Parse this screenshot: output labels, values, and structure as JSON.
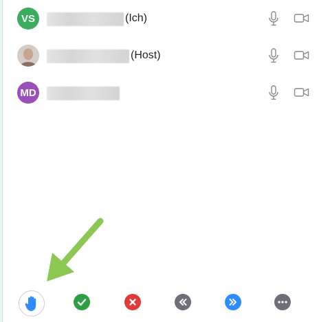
{
  "participants": [
    {
      "initials": "VS",
      "role": "(Ich)",
      "avatar_color": "#3aac5d"
    },
    {
      "initials": "",
      "role": "(Host)",
      "avatar_color": "#d9d2cc"
    },
    {
      "initials": "MD",
      "role": "",
      "avatar_color": "#9b4fb8"
    }
  ],
  "toolbar": {
    "raise_hand": "raise-hand-icon",
    "yes": "checkmark-icon",
    "no": "x-icon",
    "slower": "double-chevron-left-icon",
    "faster": "double-chevron-right-icon",
    "more": "ellipsis-icon"
  },
  "colors": {
    "accent_green": "#2ea043",
    "red": "#e03a3a",
    "gray": "#6e6e78",
    "blue": "#2d8cff",
    "arrow_green": "#8cc653"
  }
}
